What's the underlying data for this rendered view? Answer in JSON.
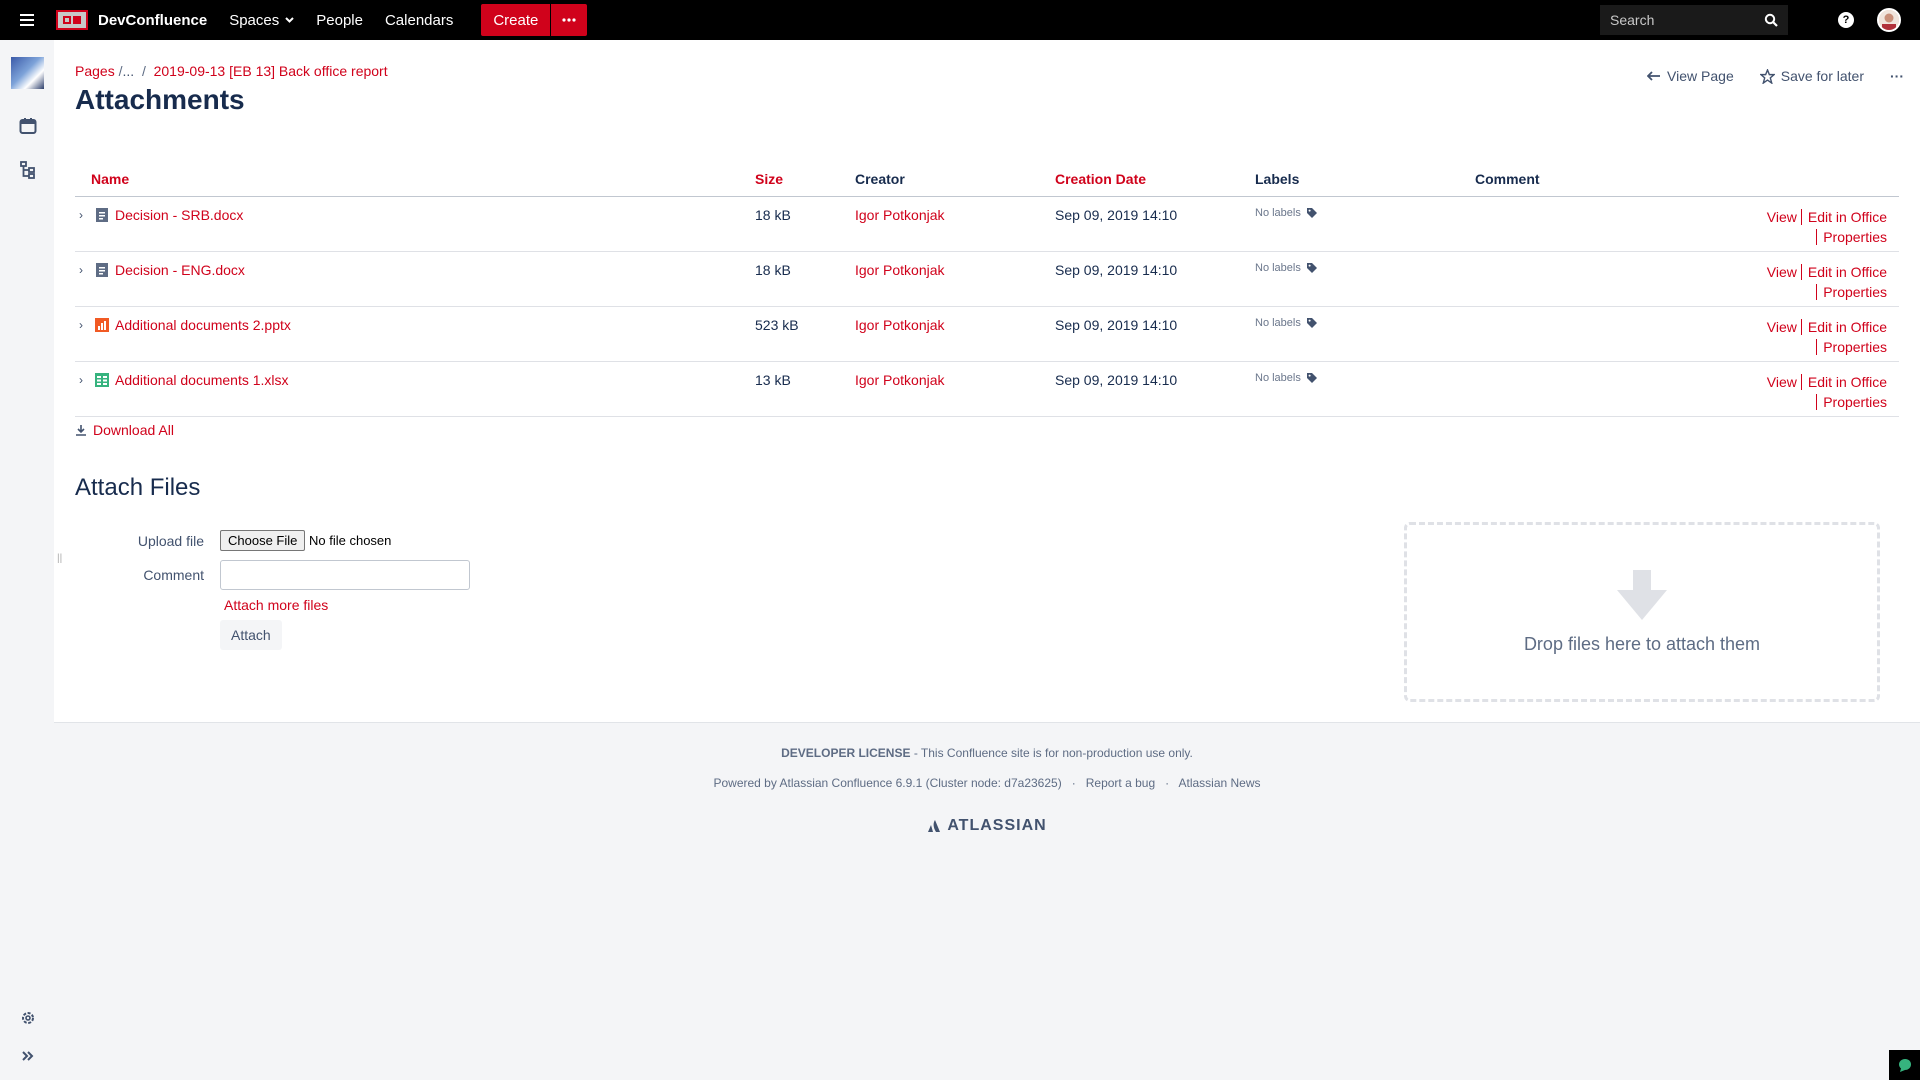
{
  "topbar": {
    "brand": "DevConfluence",
    "nav": [
      "Spaces",
      "People",
      "Calendars"
    ],
    "create_label": "Create",
    "search_placeholder": "Search",
    "help": "?"
  },
  "breadcrumb": {
    "root": "Pages",
    "ellipsis": "...",
    "parent": "2019-09-13 [EB 13] Back office report",
    "sep": "/"
  },
  "page": {
    "title": "Attachments",
    "view_page": "View Page",
    "save_for_later": "Save for later",
    "more": "···"
  },
  "table": {
    "headers": {
      "name": "Name",
      "size": "Size",
      "creator": "Creator",
      "creation_date": "Creation Date",
      "labels": "Labels",
      "comment": "Comment"
    },
    "rows": [
      {
        "name": "Decision - SRB.docx",
        "type": "docx",
        "size": "18 kB",
        "creator": "Igor Potkonjak",
        "date": "Sep 09, 2019 14:10",
        "labels": "No labels"
      },
      {
        "name": "Decision - ENG.docx",
        "type": "docx",
        "size": "18 kB",
        "creator": "Igor Potkonjak",
        "date": "Sep 09, 2019 14:10",
        "labels": "No labels"
      },
      {
        "name": "Additional documents 2.pptx",
        "type": "pptx",
        "size": "523 kB",
        "creator": "Igor Potkonjak",
        "date": "Sep 09, 2019 14:10",
        "labels": "No labels"
      },
      {
        "name": "Additional documents 1.xlsx",
        "type": "xlsx",
        "size": "13 kB",
        "creator": "Igor Potkonjak",
        "date": "Sep 09, 2019 14:10",
        "labels": "No labels"
      }
    ],
    "row_actions": {
      "view": "View",
      "edit_office": "Edit in Office",
      "properties": "Properties"
    }
  },
  "download_all": "Download All",
  "attach": {
    "heading": "Attach Files",
    "upload_label": "Upload file",
    "choose_file": "Choose File",
    "no_file": "No file chosen",
    "comment_label": "Comment",
    "attach_more": "Attach more files",
    "attach_button": "Attach",
    "drop_text": "Drop files here to attach them"
  },
  "footer": {
    "license_bold": "DEVELOPER LICENSE",
    "license_rest": " - This Confluence site is for non-production use only.",
    "powered": "Powered by Atlassian Confluence 6.9.1 (Cluster node: d7a23625)",
    "report_bug": "Report a bug",
    "news": "Atlassian News",
    "dot": "·",
    "logo_text": "ATLASSIAN"
  },
  "colors": {
    "accent": "#d0021b",
    "topbar": "#000000",
    "docx": "#5e6c84",
    "pptx": "#f15a24",
    "xlsx": "#36b37e"
  }
}
